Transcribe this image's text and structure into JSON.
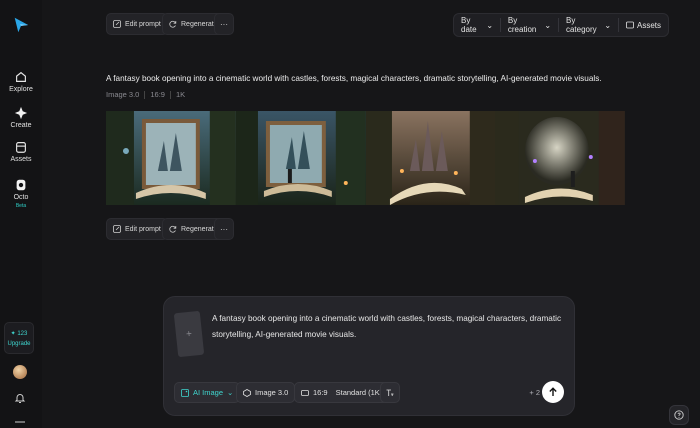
{
  "sidebar": {
    "items": [
      {
        "label": "Explore",
        "icon": "home-icon"
      },
      {
        "label": "Create",
        "icon": "sparkle-icon"
      },
      {
        "label": "Assets",
        "icon": "folder-icon"
      },
      {
        "label": "Octo",
        "icon": "octo-icon"
      }
    ],
    "beta_badge": "Beta",
    "credits": {
      "amount": "123",
      "upgrade_label": "Upgrade"
    }
  },
  "top_actions": {
    "edit_prompt": "Edit prompt",
    "regenerate": "Regenerate"
  },
  "filters": {
    "by_date": "By date",
    "by_creation": "By creation",
    "by_category": "By category",
    "assets": "Assets"
  },
  "generation": {
    "prompt": "A fantasy book opening into a cinematic world with castles, forests, magical characters, dramatic storytelling, AI-generated movie visuals.",
    "model": "Image 3.0",
    "ratio": "16:9",
    "resolution": "1K",
    "image_count": 4
  },
  "bottom_actions": {
    "edit_prompt": "Edit prompt",
    "regenerate": "Regenerate"
  },
  "composer": {
    "text": "A fantasy book opening into a cinematic world with castles, forests, magical characters, dramatic storytelling, AI-generated movie visuals.",
    "mode": "AI Image",
    "model": "Image 3.0",
    "ratio": "16:9",
    "quality": "Standard (1K)",
    "cost": "+ 2"
  },
  "colors": {
    "accent": "#3fd6cf",
    "background": "#161618"
  }
}
